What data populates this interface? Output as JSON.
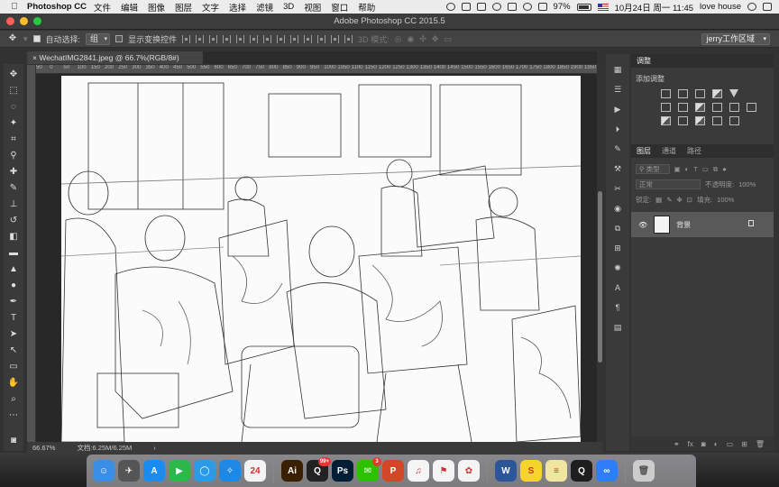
{
  "menubar": {
    "app_name": "Photoshop CC",
    "items": [
      "文件",
      "编辑",
      "图像",
      "图层",
      "文字",
      "选择",
      "滤镜",
      "3D",
      "视图",
      "窗口",
      "帮助"
    ],
    "battery": "97%",
    "clock": "10月24日 周一  11:45",
    "user": "love house"
  },
  "window": {
    "title": "Adobe Photoshop CC 2015.5"
  },
  "options_bar": {
    "auto_select_label": "自动选择:",
    "auto_select_value": "组",
    "show_transform_label": "显示变换控件",
    "mode_3d_label": "3D 模式:",
    "workspace": "jerry工作区域"
  },
  "document": {
    "tab_title": "WechatIMG2841.jpeg @ 66.7%(RGB/8#)",
    "zoom": "66.67%",
    "doc_size": "文档:6.25M/6.25M",
    "ruler_labels": [
      "50",
      "0",
      "50",
      "100",
      "150",
      "200",
      "250",
      "300",
      "350",
      "400",
      "450",
      "500",
      "550",
      "600",
      "650",
      "700",
      "750",
      "800",
      "850",
      "900",
      "950",
      "1000",
      "1050",
      "1100",
      "1150",
      "1200",
      "1250",
      "1300",
      "1350",
      "1400",
      "1450",
      "1500",
      "1550",
      "1600",
      "1650",
      "1700",
      "1750",
      "1800",
      "1850",
      "1900",
      "1950"
    ]
  },
  "panels": {
    "adjust_tab": "调整",
    "add_adjustment": "添加调整",
    "tabs": [
      "图层",
      "通道",
      "路径"
    ],
    "filter_type": "类型",
    "blend_mode": "正常",
    "opacity_label": "不透明度:",
    "opacity_value": "100%",
    "lock_label": "锁定:",
    "fill_label": "填充:",
    "fill_value": "100%",
    "layer_name": "背景"
  },
  "dock": {
    "apps": [
      {
        "name": "finder",
        "glyph": "☺",
        "color": "#3a8ee6"
      },
      {
        "name": "launchpad",
        "glyph": "✈",
        "color": "#555"
      },
      {
        "name": "app-store",
        "glyph": "A",
        "color": "#1a8cf0"
      },
      {
        "name": "facetime",
        "glyph": "▶",
        "color": "#2cb84a"
      },
      {
        "name": "qq-browser",
        "glyph": "◯",
        "color": "#2b9be8"
      },
      {
        "name": "safari",
        "glyph": "✧",
        "color": "#1e88e5"
      },
      {
        "name": "calendar",
        "glyph": "24",
        "color": "#f4f4f4"
      },
      {
        "name": "illustrator",
        "glyph": "Ai",
        "color": "#3a1f00"
      },
      {
        "name": "qq",
        "glyph": "Q",
        "color": "#222"
      },
      {
        "name": "photoshop",
        "glyph": "Ps",
        "color": "#001e36"
      },
      {
        "name": "wechat",
        "glyph": "✉",
        "color": "#2dc100"
      },
      {
        "name": "powerpoint",
        "glyph": "P",
        "color": "#d24726"
      },
      {
        "name": "music",
        "glyph": "♫",
        "color": "#f5f5f5"
      },
      {
        "name": "acrobat",
        "glyph": "⚑",
        "color": "#f4f4f4"
      },
      {
        "name": "photos",
        "glyph": "✿",
        "color": "#f4f4f4"
      },
      {
        "name": "word",
        "glyph": "W",
        "color": "#2b579a"
      },
      {
        "name": "stickies",
        "glyph": "S",
        "color": "#f6d32d"
      },
      {
        "name": "notes",
        "glyph": "≡",
        "color": "#f1e6a0"
      },
      {
        "name": "quicktime",
        "glyph": "Q",
        "color": "#1e1e1e"
      },
      {
        "name": "baidu-netdisk",
        "glyph": "∞",
        "color": "#2f7ef7"
      }
    ],
    "badges": {
      "qq": "99+",
      "wechat": "3"
    },
    "calendar_day": "24",
    "trash": "trash-icon"
  }
}
